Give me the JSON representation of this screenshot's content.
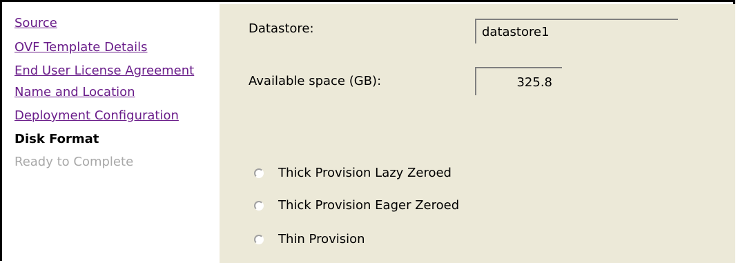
{
  "sidebar": {
    "items": [
      {
        "label": "Source",
        "state": "visited-link"
      },
      {
        "label": "OVF Template Details",
        "state": "visited-link"
      },
      {
        "label": "End User License Agreement",
        "state": "visited-link"
      },
      {
        "label": "Name and Location",
        "state": "visited-link"
      },
      {
        "label": "Deployment Configuration",
        "state": "visited-link"
      },
      {
        "label": "Disk Format",
        "state": "current"
      },
      {
        "label": "Ready to Complete",
        "state": "disabled"
      }
    ]
  },
  "main": {
    "datastore_label": "Datastore:",
    "datastore_value": "datastore1",
    "available_space_label": "Available space (GB):",
    "available_space_value": "325.8",
    "disk_format_options": [
      {
        "label": "Thick Provision Lazy Zeroed",
        "selected": false
      },
      {
        "label": "Thick Provision Eager Zeroed",
        "selected": false
      },
      {
        "label": "Thin Provision",
        "selected": false
      }
    ]
  },
  "colors": {
    "link_visited": "#6a1d8a",
    "panel_background": "#ece9d8",
    "disabled_text": "#a8a8a8"
  }
}
